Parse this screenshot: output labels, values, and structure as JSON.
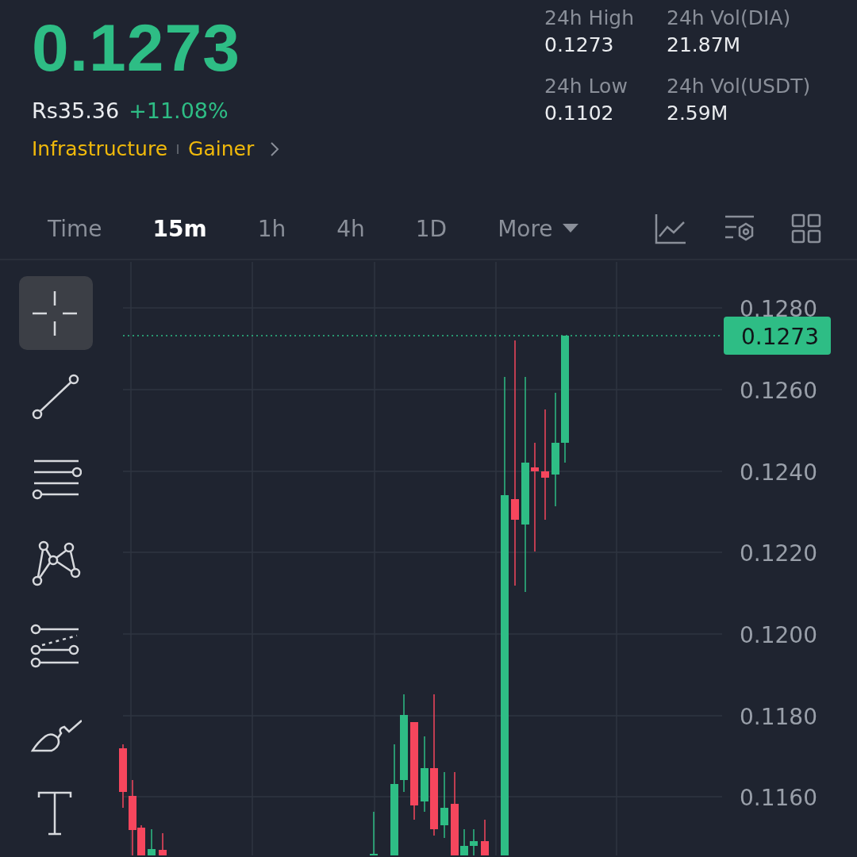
{
  "price": "0.1273",
  "fiat_price": "Rs35.36",
  "change": "+11.08%",
  "tags": [
    "Infrastructure",
    "Gainer"
  ],
  "stats": [
    {
      "label": "24h High",
      "value": "0.1273"
    },
    {
      "label": "24h Vol(DIA)",
      "value": "21.87M"
    },
    {
      "label": "24h Low",
      "value": "0.1102"
    },
    {
      "label": "24h Vol(USDT)",
      "value": "2.59M"
    }
  ],
  "intervals": [
    {
      "label": "Time",
      "selected": false,
      "kind": "plain"
    },
    {
      "label": "15m",
      "selected": true,
      "kind": "plain"
    },
    {
      "label": "1h",
      "selected": false,
      "kind": "plain"
    },
    {
      "label": "4h",
      "selected": false,
      "kind": "plain"
    },
    {
      "label": "1D",
      "selected": false,
      "kind": "plain"
    },
    {
      "label": "More",
      "selected": false,
      "kind": "dropdown"
    }
  ],
  "chart_tools": [
    {
      "kind": "indicator"
    },
    {
      "kind": "settings"
    },
    {
      "kind": "layout"
    }
  ],
  "drawing_tools": [
    {
      "kind": "crosshair",
      "selected": true
    },
    {
      "kind": "trend-line",
      "selected": false
    },
    {
      "kind": "parallel-lines",
      "selected": false
    },
    {
      "kind": "pattern",
      "selected": false
    },
    {
      "kind": "fib",
      "selected": false
    },
    {
      "kind": "brush",
      "selected": false
    },
    {
      "kind": "text",
      "selected": false
    }
  ],
  "chart": {
    "price_labels": [
      "0.1280",
      "0.1260",
      "0.1240",
      "0.1220",
      "0.1200",
      "0.1180",
      "0.1160"
    ],
    "last_price": "0.1273"
  }
}
